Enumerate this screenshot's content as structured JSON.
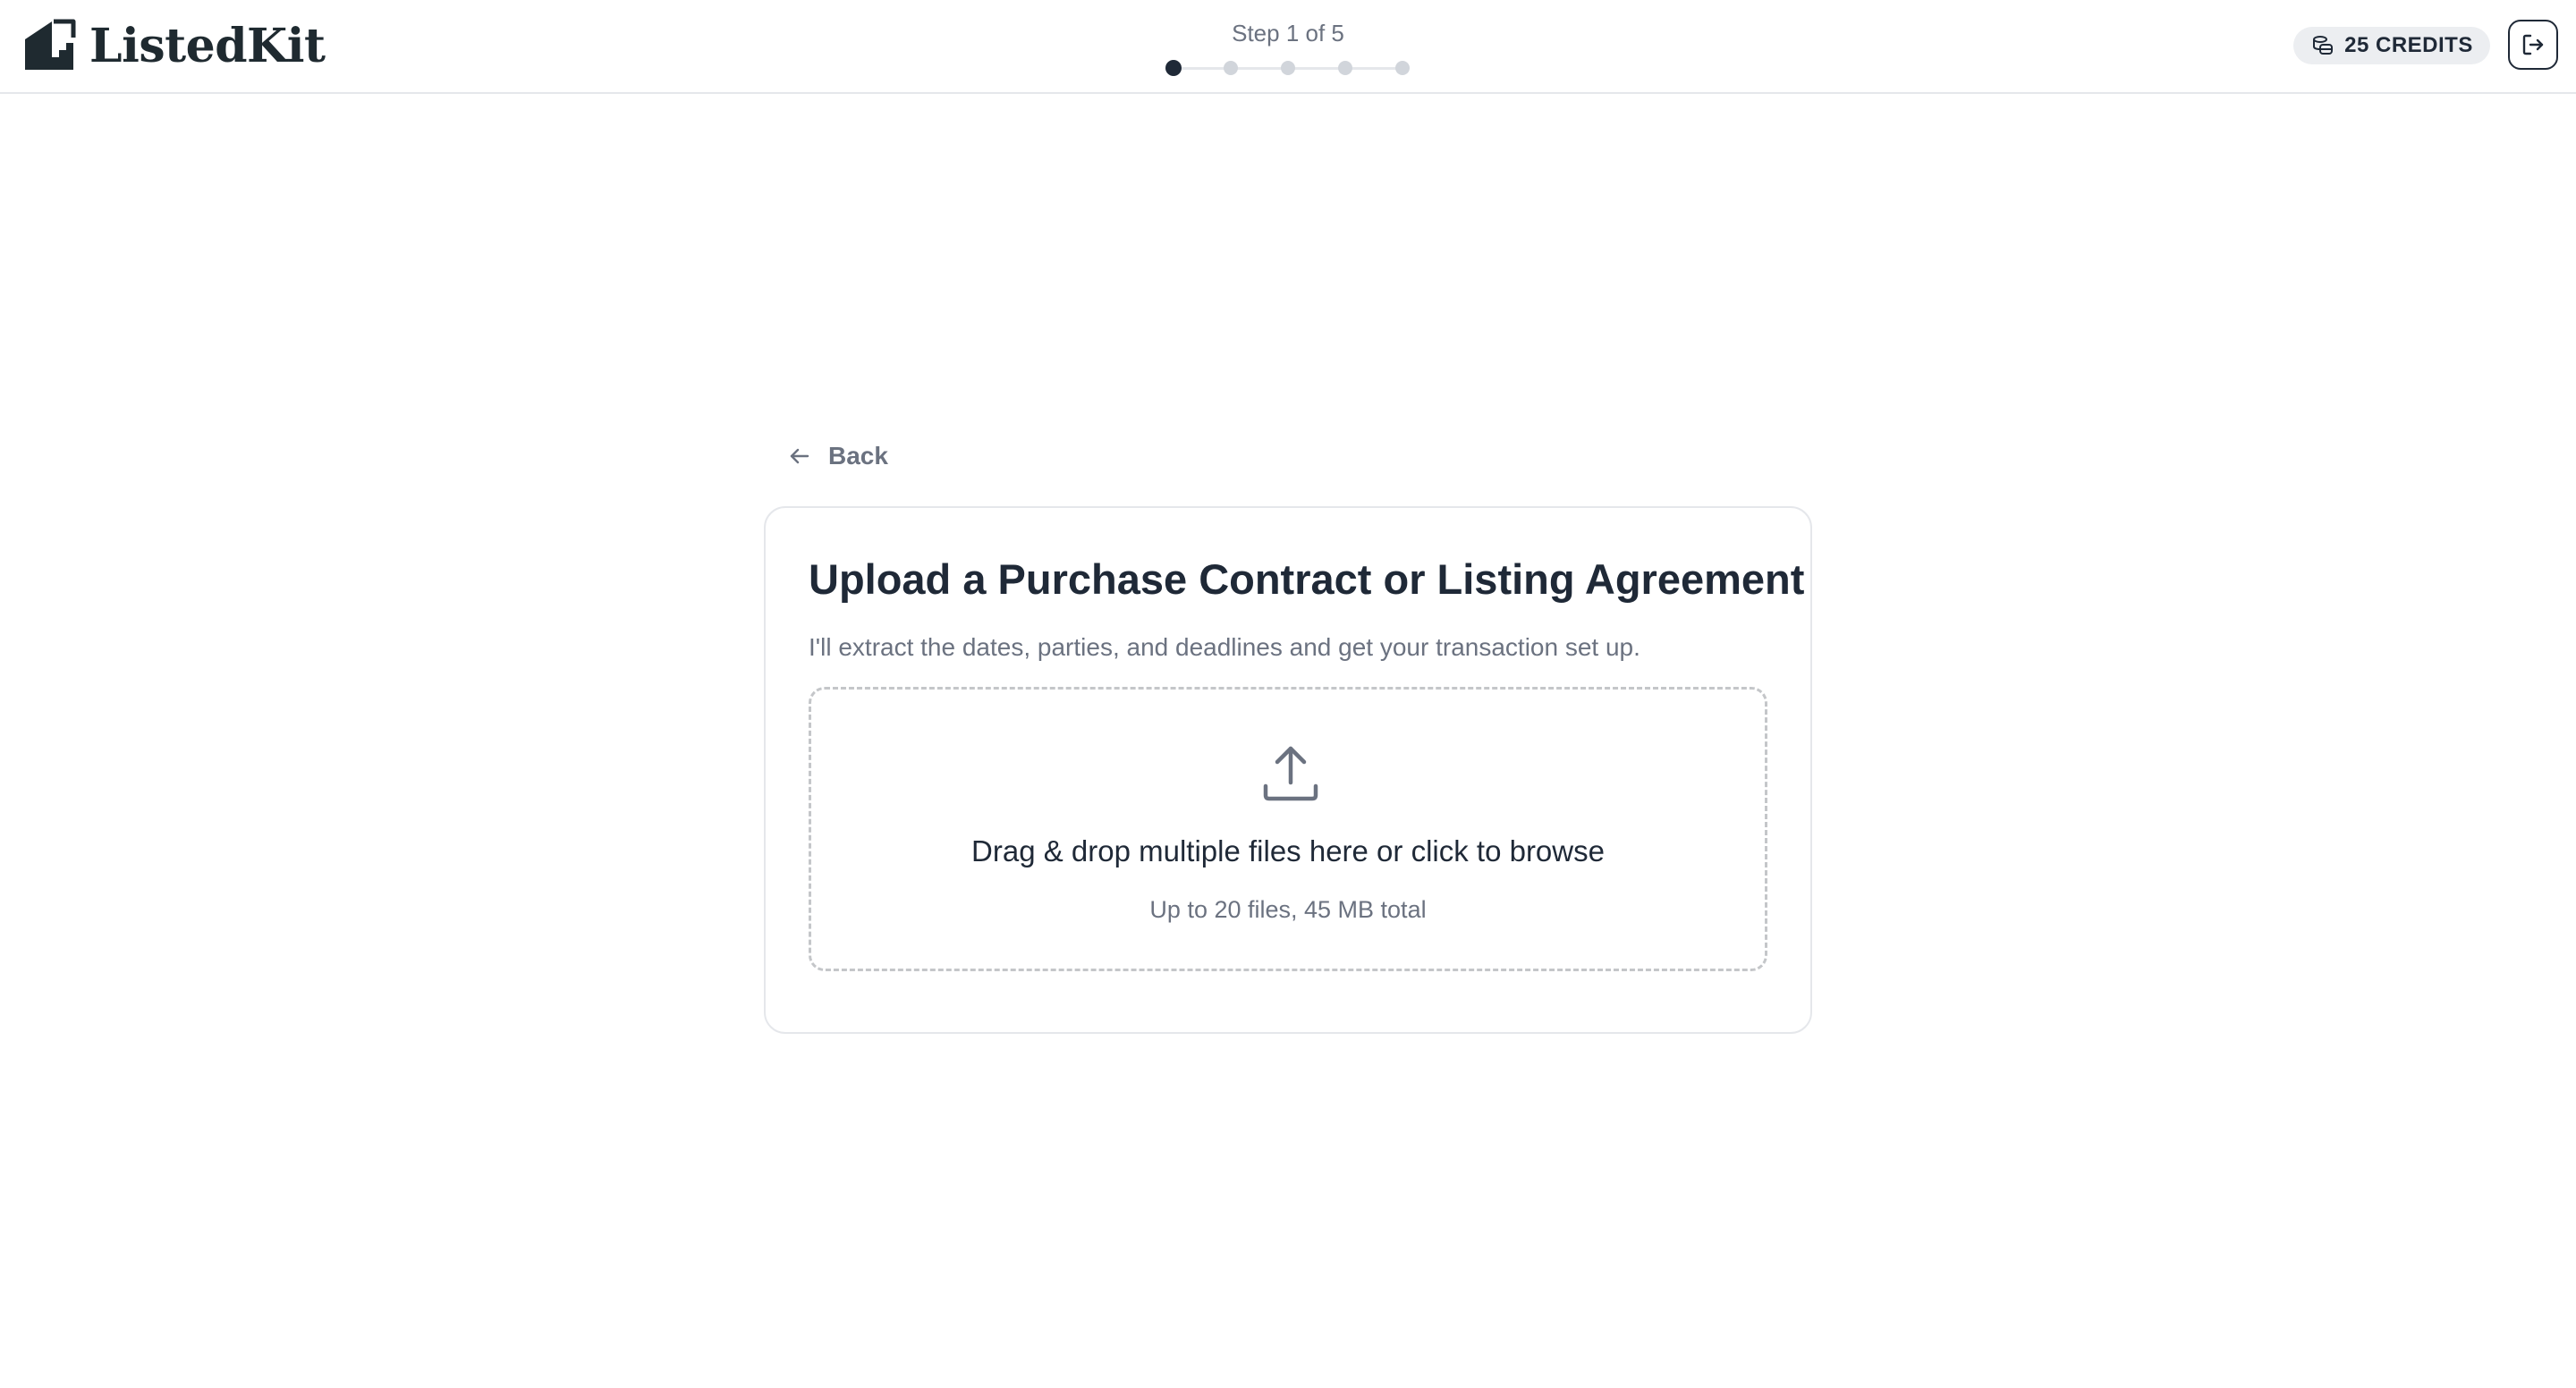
{
  "header": {
    "brand_name": "ListedKit",
    "brand_icon": "house-stairs-logo",
    "stepper": {
      "label": "Step 1 of 5",
      "current_step": 1,
      "total_steps": 5
    },
    "credits_label": "25 CREDITS",
    "credits_icon": "coins-icon",
    "logout_icon": "logout-icon"
  },
  "back": {
    "label": "Back",
    "icon": "arrow-left-icon"
  },
  "upload_card": {
    "title": "Upload a Purchase Contract or Listing Agreement",
    "subtitle": "I'll extract the dates, parties, and deadlines and get your transaction set up.",
    "dropzone": {
      "icon": "upload-icon",
      "primary_text": "Drag & drop multiple files here or click to browse",
      "secondary_text": "Up to 20 files, 45 MB total"
    }
  },
  "colors": {
    "text_primary": "#1f2937",
    "text_muted": "#6b7280",
    "border": "#e5e7eb",
    "dashed_border": "#c4c6c9",
    "credits_bg": "#eceef1"
  }
}
